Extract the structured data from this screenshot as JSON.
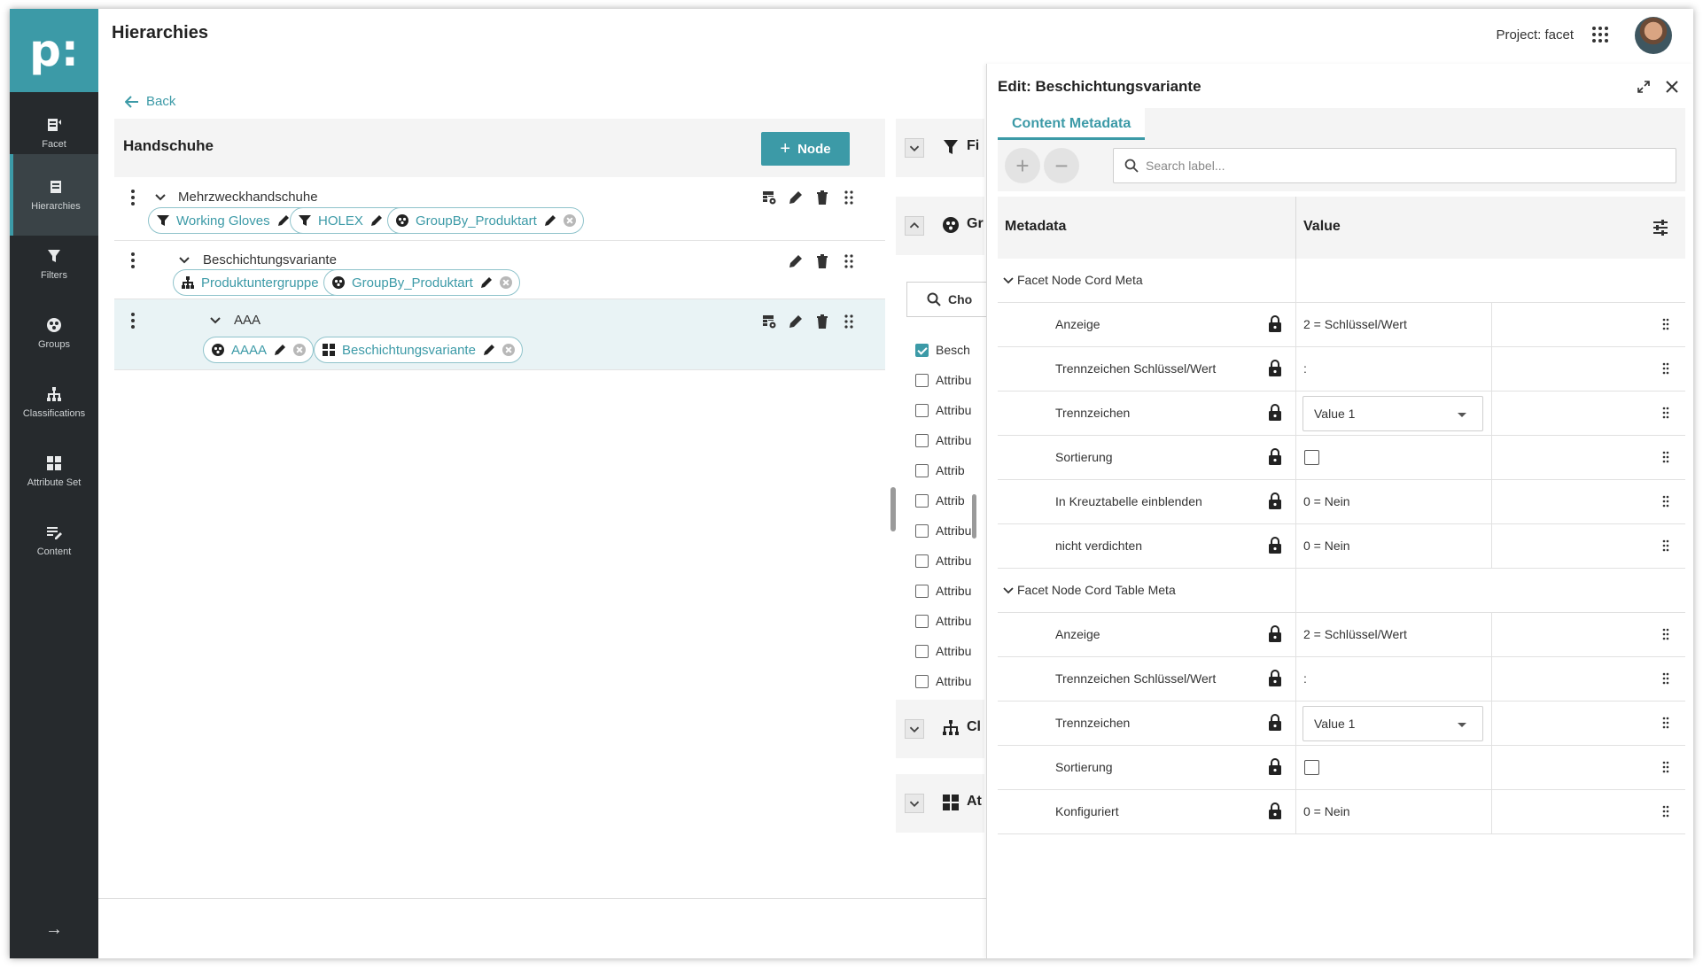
{
  "app": {
    "logo": "p:",
    "page_title": "Hierarchies",
    "project_label": "Project: facet"
  },
  "sidebar": {
    "items": [
      {
        "label": "Facet",
        "icon": "facet-icon"
      },
      {
        "label": "Hierarchies",
        "icon": "hierarchies-icon",
        "active": true
      },
      {
        "label": "Filters",
        "icon": "filter-icon"
      },
      {
        "label": "Groups",
        "icon": "groups-icon"
      },
      {
        "label": "Classifications",
        "icon": "classification-icon"
      },
      {
        "label": "Attribute Set",
        "icon": "attribute-set-icon"
      },
      {
        "label": "Content",
        "icon": "content-icon"
      }
    ],
    "collapse_icon": "→"
  },
  "tree": {
    "back_label": "Back",
    "title": "Handschuhe",
    "add_node_label": "Node",
    "nodes": [
      {
        "name": "Mehrzweckhandschuhe",
        "chips": [
          {
            "label": "Working Gloves",
            "icon": "filter-icon"
          },
          {
            "label": "HOLEX",
            "icon": "filter-icon"
          },
          {
            "label": "GroupBy_Produktart",
            "icon": "groups-icon"
          }
        ]
      },
      {
        "name": "Beschichtungsvariante",
        "chips": [
          {
            "label": "Produktuntergruppe",
            "icon": "classification-icon"
          },
          {
            "label": "GroupBy_Produktart",
            "icon": "groups-icon"
          }
        ]
      },
      {
        "name": "AAA",
        "chips": [
          {
            "label": "AAAA",
            "icon": "groups-icon"
          },
          {
            "label": "Beschichtungsvariante",
            "icon": "attribute-set-icon"
          }
        ]
      }
    ]
  },
  "middle": {
    "sections": [
      "Fi",
      "Gr",
      "Cl",
      "At"
    ],
    "search_placeholder": "Cho",
    "items": [
      {
        "label": "Besch",
        "checked": true
      },
      {
        "label": "Attribu",
        "checked": false
      },
      {
        "label": "Attribu",
        "checked": false
      },
      {
        "label": "Attribu",
        "checked": false
      },
      {
        "label": "Attrib",
        "checked": false
      },
      {
        "label": "Attrib",
        "checked": false
      },
      {
        "label": "Attribu",
        "checked": false
      },
      {
        "label": "Attribu",
        "checked": false
      },
      {
        "label": "Attribu",
        "checked": false
      },
      {
        "label": "Attribu",
        "checked": false
      },
      {
        "label": "Attribu",
        "checked": false
      },
      {
        "label": "Attribu",
        "checked": false
      }
    ]
  },
  "editor": {
    "title": "Edit: Beschichtungsvariante",
    "tab": "Content Metadata",
    "search_placeholder": "Search label...",
    "col_metadata": "Metadata",
    "col_value": "Value",
    "groups": [
      {
        "name": "Facet Node Cord Meta",
        "rows": [
          {
            "label": "Anzeige",
            "value": "2 = Schlüssel/Wert",
            "kind": "text"
          },
          {
            "label": "Trennzeichen Schlüssel/Wert",
            "value": ":",
            "kind": "text"
          },
          {
            "label": "Trennzeichen",
            "value": "Value 1",
            "kind": "select"
          },
          {
            "label": "Sortierung",
            "value": "",
            "kind": "checkbox"
          },
          {
            "label": "In Kreuztabelle einblenden",
            "value": "0 = Nein",
            "kind": "text"
          },
          {
            "label": "nicht verdichten",
            "value": "0 = Nein",
            "kind": "text"
          }
        ]
      },
      {
        "name": "Facet Node Cord Table Meta",
        "rows": [
          {
            "label": "Anzeige",
            "value": "2 = Schlüssel/Wert",
            "kind": "text"
          },
          {
            "label": "Trennzeichen Schlüssel/Wert",
            "value": ":",
            "kind": "text"
          },
          {
            "label": "Trennzeichen",
            "value": "Value 1",
            "kind": "select"
          },
          {
            "label": "Sortierung",
            "value": "",
            "kind": "checkbox"
          },
          {
            "label": "Konfiguriert",
            "value": "0 = Nein",
            "kind": "text"
          }
        ]
      }
    ]
  },
  "colors": {
    "accent": "#3c9aa7",
    "sidebar": "#262a2d"
  }
}
